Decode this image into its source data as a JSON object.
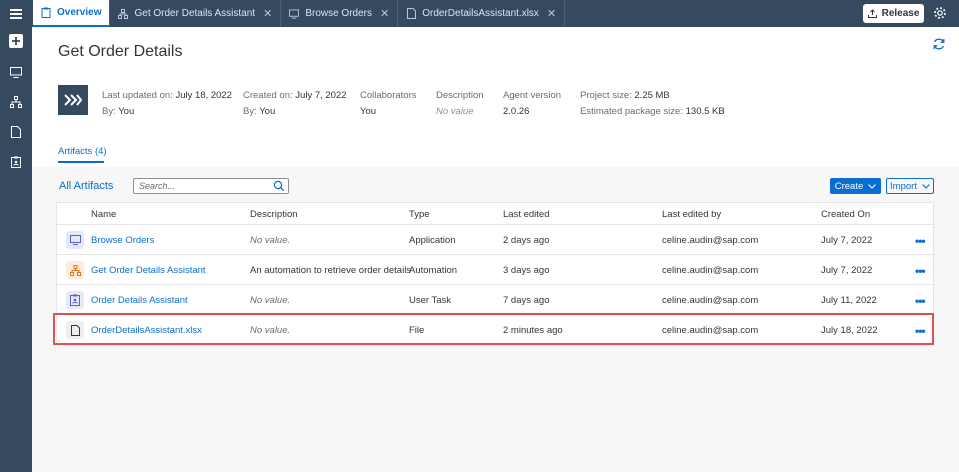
{
  "tabs": [
    {
      "label": "Overview",
      "icon": "clipboard-icon",
      "active": true
    },
    {
      "label": "Get Order Details Assistant",
      "icon": "automation-icon",
      "active": false
    },
    {
      "label": "Browse Orders",
      "icon": "monitor-icon",
      "active": false
    },
    {
      "label": "OrderDetailsAssistant.xlsx",
      "icon": "file-icon",
      "active": false
    }
  ],
  "close_glyph": "✕",
  "release_label": "Release",
  "page_title": "Get Order Details",
  "meta": {
    "last_updated_label": "Last updated on:",
    "last_updated_value": "July 18, 2022",
    "by_label": "By:",
    "updated_by": "You",
    "created_label": "Created on:",
    "created_value": "July 7, 2022",
    "created_by": "You",
    "collaborators_label": "Collaborators",
    "collaborators_value": "You",
    "description_label": "Description",
    "description_value": "No value",
    "agent_version_label": "Agent version",
    "agent_version_value": "2.0.26",
    "project_size_label": "Project size:",
    "project_size_value": "2.25 MB",
    "package_size_label": "Estimated package size:",
    "package_size_value": "130.5 KB"
  },
  "artifacts_tab": "Artifacts (4)",
  "toolbar": {
    "title": "All Artifacts",
    "search_placeholder": "Search...",
    "create_label": "Create",
    "import_label": "Import"
  },
  "table": {
    "headers": [
      "Name",
      "Description",
      "Type",
      "Last edited",
      "Last edited by",
      "Created On"
    ],
    "rows": [
      {
        "icon": "monitor-icon",
        "name": "Browse Orders",
        "description": "No value.",
        "type": "Application",
        "last_edited": "2 days ago",
        "edited_by": "celine.audin@sap.com",
        "created_on": "July 7, 2022"
      },
      {
        "icon": "automation-icon",
        "name": "Get Order Details Assistant",
        "description": "An automation to retrieve order details",
        "type": "Automation",
        "last_edited": "3 days ago",
        "edited_by": "celine.audin@sap.com",
        "created_on": "July 7, 2022"
      },
      {
        "icon": "user-task-icon",
        "name": "Order Details Assistant",
        "description": "No value.",
        "type": "User Task",
        "last_edited": "7 days ago",
        "edited_by": "celine.audin@sap.com",
        "created_on": "July 11, 2022"
      },
      {
        "icon": "file-icon",
        "name": "OrderDetailsAssistant.xlsx",
        "description": "No value.",
        "type": "File",
        "last_edited": "2 minutes ago",
        "edited_by": "celine.audin@sap.com",
        "created_on": "July 18, 2022"
      }
    ],
    "more_glyph": "•••"
  },
  "colors": {
    "shell": "#354a5f",
    "accent": "#0a6ed1",
    "highlight": "#d9534f"
  }
}
